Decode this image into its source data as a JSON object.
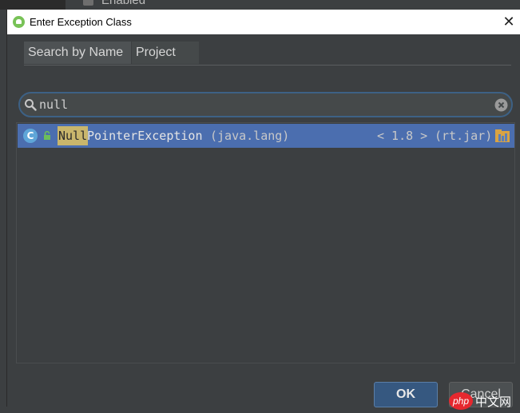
{
  "background": {
    "checkbox_label": "Enabled"
  },
  "dialog": {
    "title": "Enter Exception Class",
    "close_glyph": "✕",
    "app_icon": "android-icon"
  },
  "tabs": [
    {
      "label": "Search by Name",
      "active": true
    },
    {
      "label": "Project",
      "active": false
    }
  ],
  "search": {
    "value": "null",
    "icons": [
      "search-icon",
      "clear-icon"
    ]
  },
  "results": [
    {
      "match": "Null",
      "name_rest": "PointerException",
      "package": "(java.lang)",
      "version": "< 1.8 >",
      "jar": "(rt.jar)",
      "icon_letter": "C",
      "selected": true
    }
  ],
  "buttons": {
    "ok": "OK",
    "cancel": "Cancel"
  },
  "watermark": {
    "text": "php 中文网"
  },
  "colors": {
    "selection": "#4b6eaf",
    "match_highlight": "#c9b66c",
    "focus_border": "#3d6185",
    "dialog_bg": "#3c3f41"
  }
}
